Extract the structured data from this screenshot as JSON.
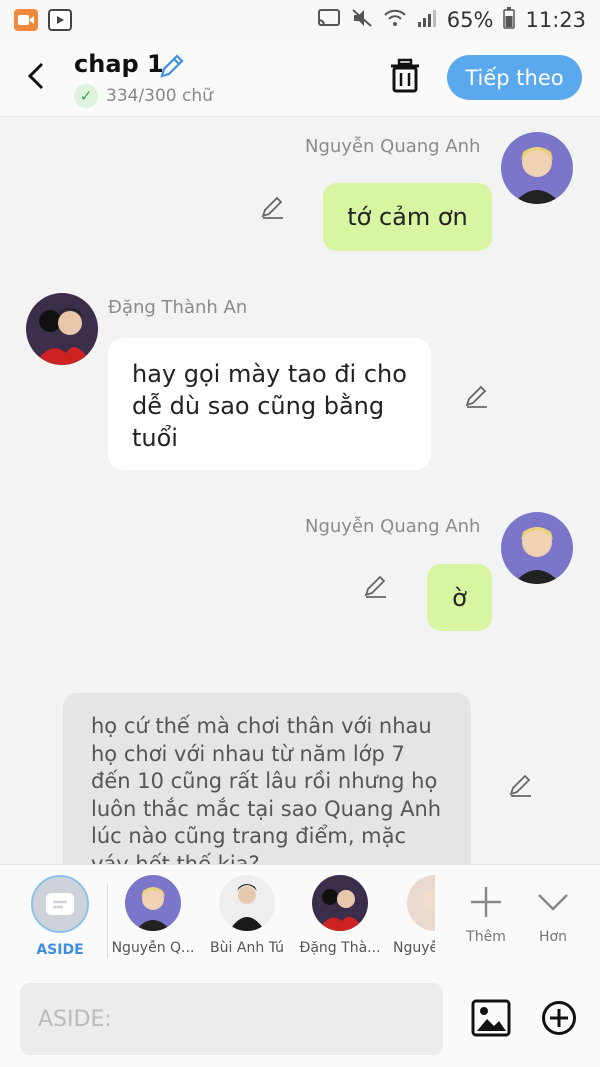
{
  "status_bar": {
    "battery": "65%",
    "time": "11:23"
  },
  "header": {
    "title": "chap 1",
    "word_count": "334/300 chữ",
    "next_label": "Tiếp theo"
  },
  "messages": [
    {
      "name": "Nguyễn Quang Anh",
      "text": "tớ cảm ơn"
    },
    {
      "name": "Đặng Thành An",
      "text": "hay gọi mày tao đi cho dễ dù sao cũng bằng tuổi"
    },
    {
      "name": "Nguyễn Quang Anh",
      "text": "ờ"
    },
    {
      "text": "họ cứ thế mà chơi thân với nhau họ chơi với nhau từ năm lớp 7 đến 10 cũng rất lâu rồi nhưng họ luôn thắc mắc tại sao Quang Anh lúc nào cũng trang điểm, mặc váy hết thế kia?"
    }
  ],
  "characters": [
    {
      "label": "ASIDE"
    },
    {
      "label": "Nguyễn Q..."
    },
    {
      "label": "Bùi Anh Tú"
    },
    {
      "label": "Đặng Thà..."
    },
    {
      "label": "Nguyễ"
    }
  ],
  "actions": {
    "add_label": "Thêm",
    "more_label": "Hơn"
  },
  "input": {
    "placeholder": "ASIDE:"
  },
  "colors": {
    "accent": "#5aa9ee",
    "bubble_right": "#d8f5a2",
    "bubble_left": "#ffffff",
    "aside_bubble": "#e5e5e5"
  }
}
